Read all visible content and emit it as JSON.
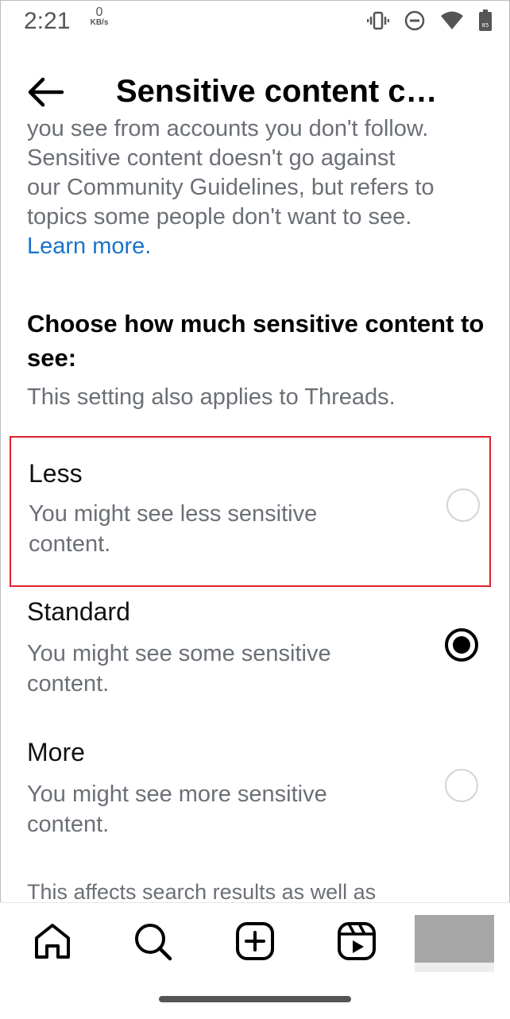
{
  "status_bar": {
    "time": "2:21",
    "net_speed_value": "0",
    "net_speed_unit": "KB/s",
    "battery_level": "85",
    "icons": [
      "vibrate-icon",
      "do-not-disturb-icon",
      "wifi-icon",
      "battery-icon"
    ]
  },
  "header": {
    "title": "Sensitive content c…",
    "back_icon": "back-arrow-icon"
  },
  "intro": {
    "lines": [
      "you see from accounts you don't follow.",
      "Sensitive content doesn't go against",
      "our Community Guidelines, but refers to",
      "topics some people don't want to see."
    ],
    "link": "Learn more."
  },
  "section": {
    "heading": "Choose how much sensitive content to see:",
    "note": "This setting also applies to Threads."
  },
  "options": [
    {
      "label": "Less",
      "description": "You might see less sensitive content.",
      "selected": false
    },
    {
      "label": "Standard",
      "description": "You might see some sensitive content.",
      "selected": true
    },
    {
      "label": "More",
      "description": "You might see more sensitive content.",
      "selected": false
    }
  ],
  "footer_note": "This affects search results as well as",
  "bottom_nav": {
    "items": [
      "home-icon",
      "search-icon",
      "create-post-icon",
      "reels-icon",
      "profile-avatar"
    ]
  },
  "colors": {
    "link": "#1a73c9",
    "secondary_text": "#6b6f76",
    "highlight_border": "#e0212d"
  }
}
